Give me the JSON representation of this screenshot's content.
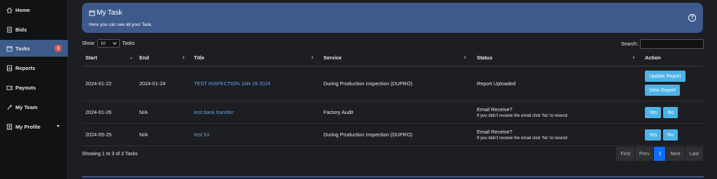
{
  "sidebar": {
    "items": [
      {
        "label": "Home",
        "icon": "home-icon"
      },
      {
        "label": "Bids",
        "icon": "document-icon"
      },
      {
        "label": "Tasks",
        "icon": "calendar-icon",
        "badge": "3"
      },
      {
        "label": "Reports",
        "icon": "report-icon"
      },
      {
        "label": "Payouts",
        "icon": "wallet-icon"
      },
      {
        "label": "My Team",
        "icon": "team-icon"
      },
      {
        "label": "My Profile",
        "icon": "profile-icon"
      }
    ]
  },
  "header": {
    "title": "My Task",
    "subtitle": "Here you can see all your Task.",
    "help_icon": "question-circle-icon"
  },
  "controls": {
    "show_label": "Show",
    "entries_value": "10",
    "entries_suffix": "Tasks",
    "search_label": "Search:",
    "search_value": ""
  },
  "table": {
    "columns": [
      "Start",
      "End",
      "Title",
      "Service",
      "Status",
      "Action"
    ],
    "rows": [
      {
        "start": "2024-01-22",
        "end": "2024-01-24",
        "title": "TEST INSPECTION JAN 19 2024",
        "service": "During Production Inspection (DUPRO)",
        "status": "Report Uploaded",
        "actions": [
          "Update Report",
          "View Report"
        ]
      },
      {
        "start": "2024-01-26",
        "end": "N/A",
        "title": "test bank transfer",
        "service": "Factory Audit",
        "status": "Email Receive?",
        "status_note": "If you didn't receive the email click 'No' to resend",
        "actions": [
          "Yes",
          "No"
        ]
      },
      {
        "start": "2024-05-25",
        "end": "N/A",
        "title": "test 53",
        "service": "During Production Inspection (DUPRO)",
        "status": "Email Receive?",
        "status_note": "If you didn't receive the email click 'No' to resend",
        "actions": [
          "Yes",
          "No"
        ]
      }
    ]
  },
  "footer": {
    "info": "Showing 1 to 3 of 3 Tasks",
    "pager": [
      "First",
      "Prev",
      "1",
      "Next",
      "Last"
    ]
  },
  "colors": {
    "accent": "#3e5a8c",
    "button": "#4cb3e8",
    "link": "#6aa0ef",
    "current_page": "#0d6efd"
  }
}
